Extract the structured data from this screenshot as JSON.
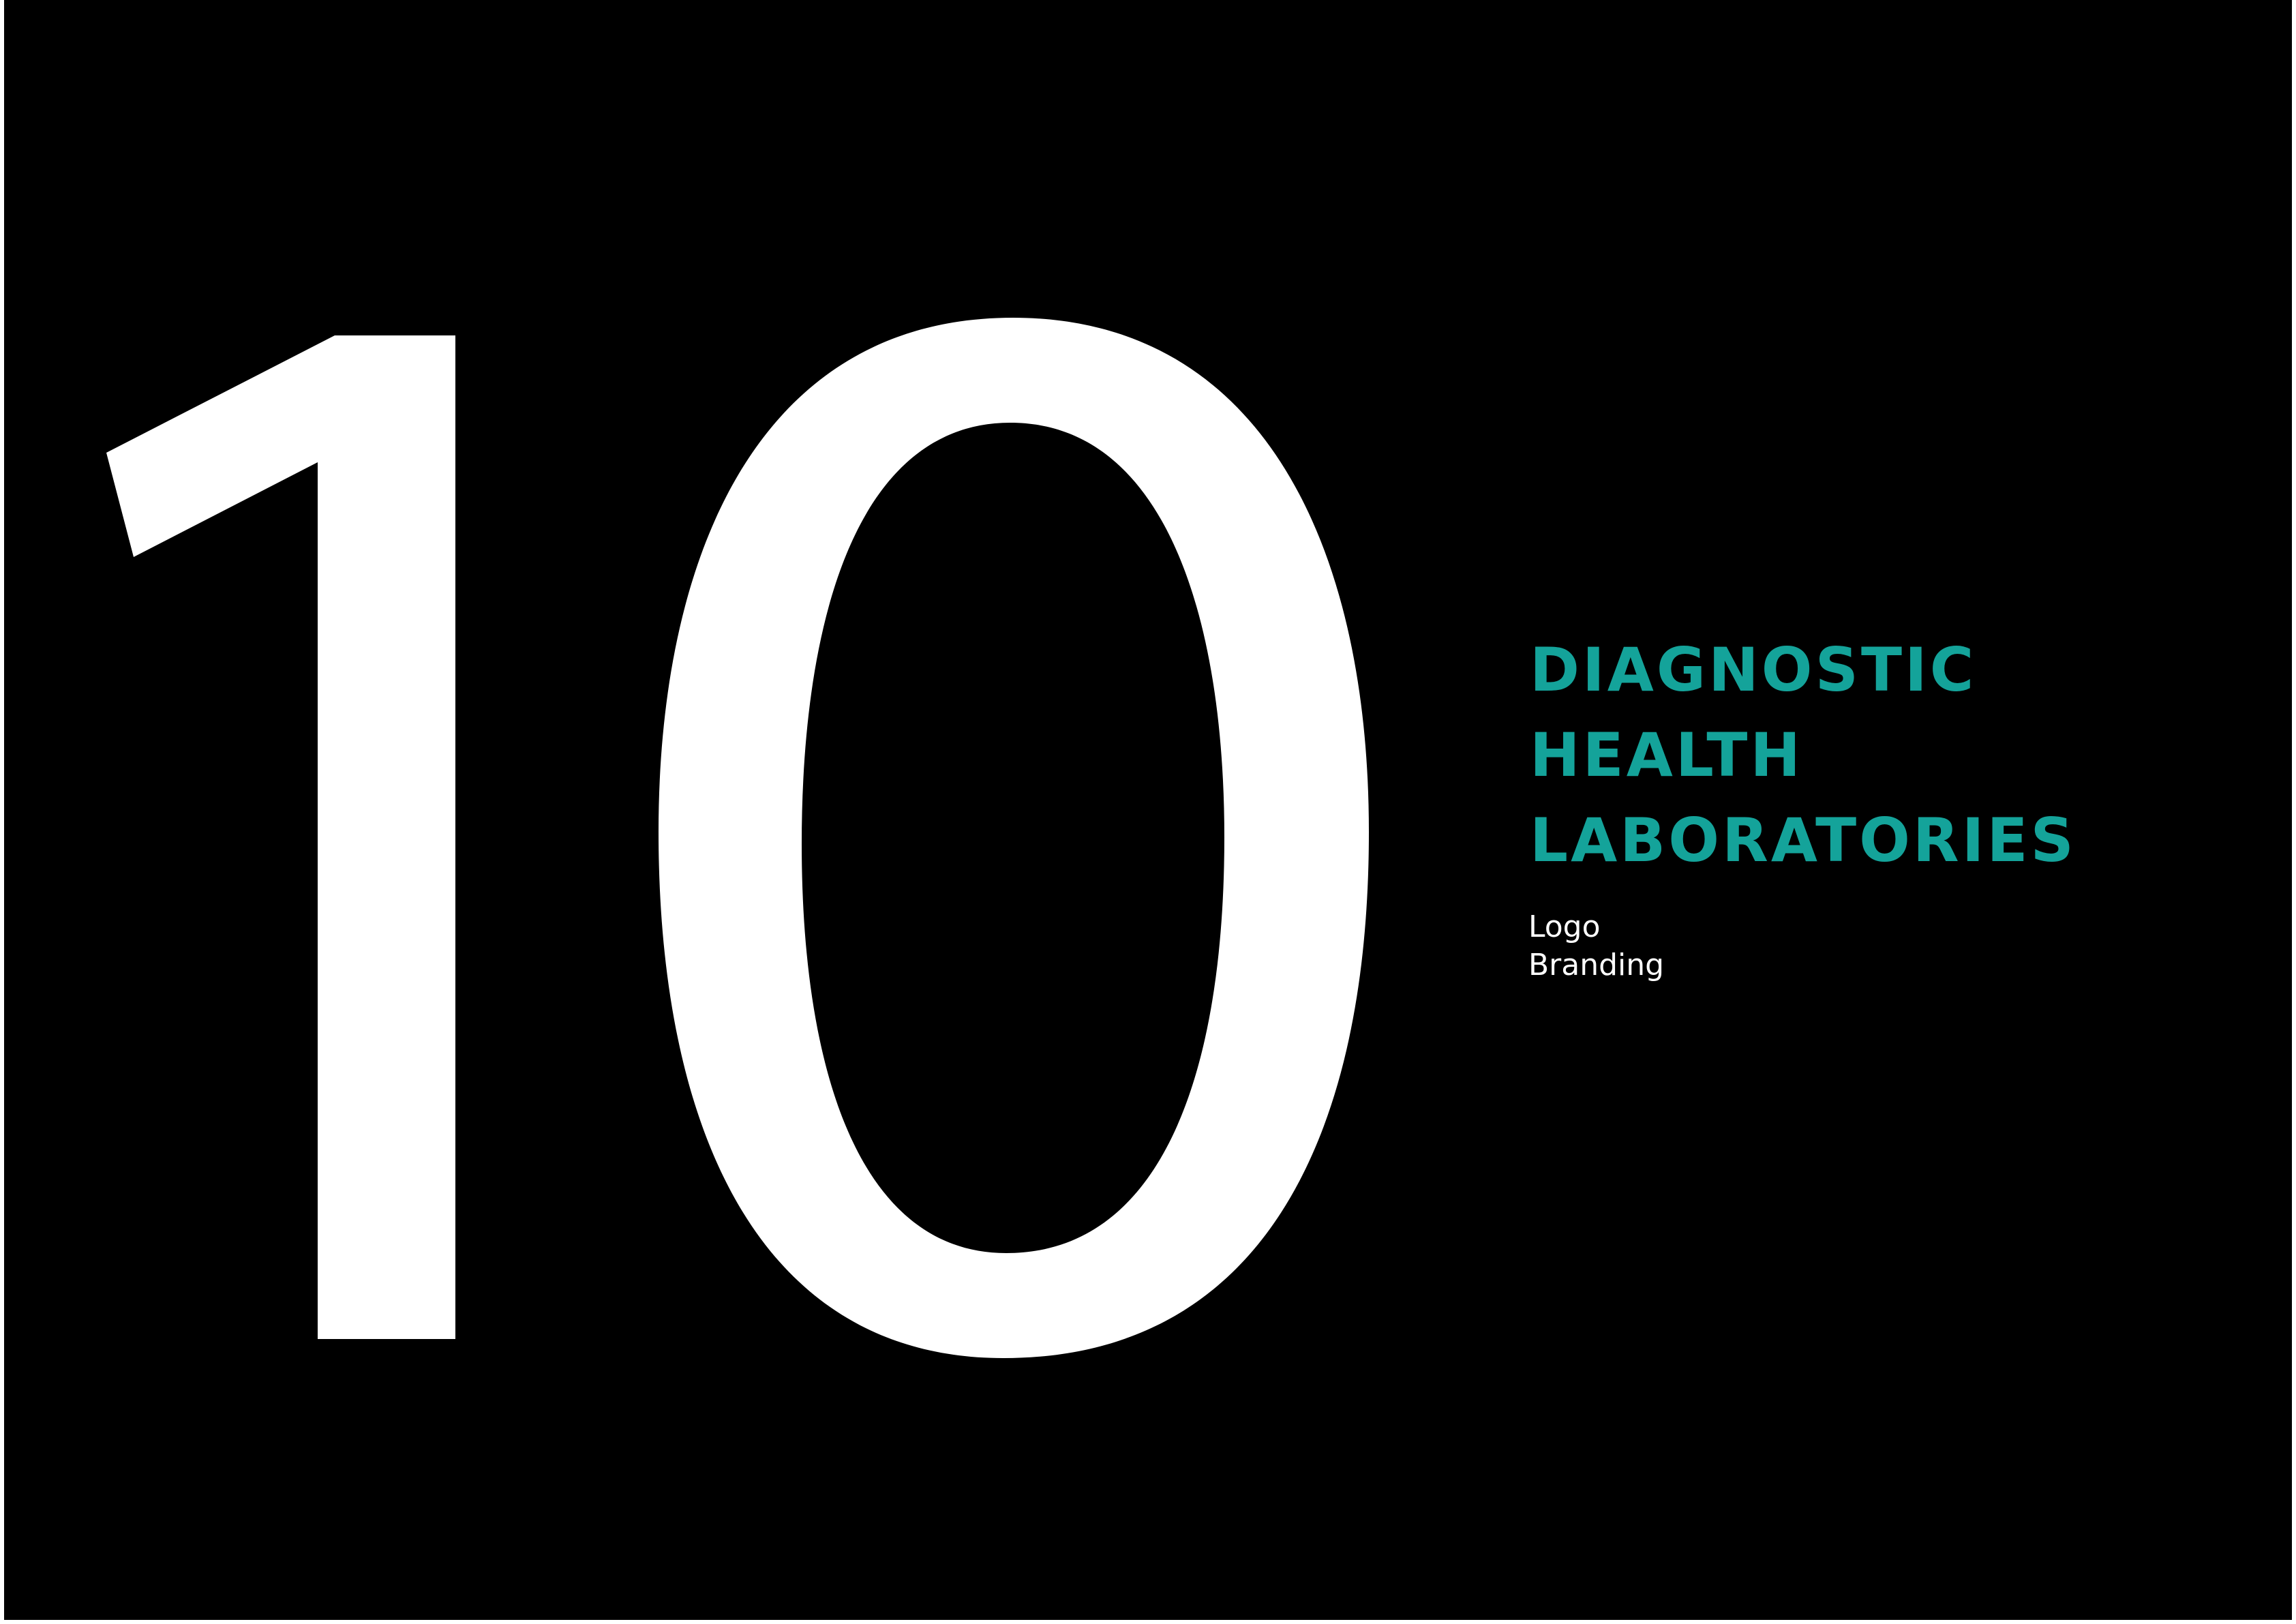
{
  "number": "10",
  "title_lines": [
    "DIAGNOSTIC",
    "HEALTH",
    "LABORATORIES"
  ],
  "subtitle_lines": [
    "Logo",
    "Branding"
  ],
  "colors": {
    "background": "#000000",
    "page_border": "#ffffff",
    "number": "#ffffff",
    "title": "#14a39a",
    "subtitle": "#ffffff"
  }
}
